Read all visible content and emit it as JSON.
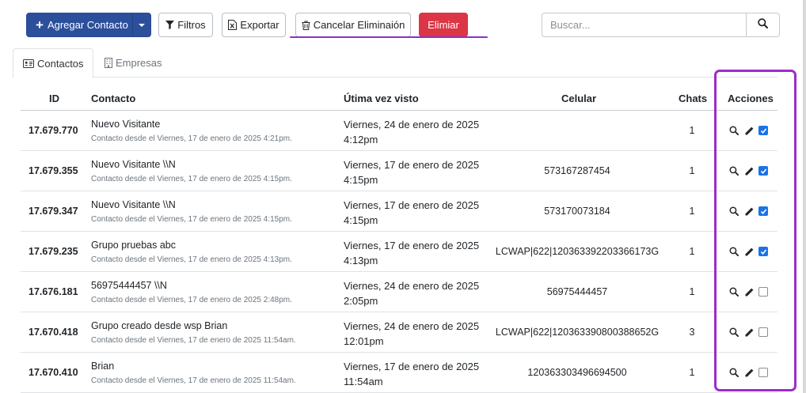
{
  "toolbar": {
    "add_contact_label": "Agregar Contacto",
    "filters_label": "Filtros",
    "export_label": "Exportar",
    "cancel_delete_label": "Cancelar Eliminaión",
    "delete_label": "Elimiar"
  },
  "search": {
    "placeholder": "Buscar..."
  },
  "tabs": [
    {
      "label": "Contactos",
      "icon": "address-card-icon",
      "active": true
    },
    {
      "label": "Empresas",
      "icon": "building-icon",
      "active": false
    }
  ],
  "table": {
    "headers": {
      "id": "ID",
      "contact": "Contacto",
      "last_seen": "Útima vez visto",
      "cell": "Celular",
      "chats": "Chats",
      "actions": "Acciones"
    },
    "rows": [
      {
        "id": "17.679.770",
        "name": "Nuevo Visitante",
        "sub": "Contacto desde el Viernes, 17 de enero de 2025 4:21pm.",
        "last_seen_1": "Viernes, 24 de enero de 2025",
        "last_seen_2": "4:12pm",
        "cell": "",
        "chats": "1",
        "checked": true
      },
      {
        "id": "17.679.355",
        "name": "Nuevo Visitante \\\\N",
        "sub": "Contacto desde el Viernes, 17 de enero de 2025 4:15pm.",
        "last_seen_1": "Viernes, 17 de enero de 2025",
        "last_seen_2": "4:15pm",
        "cell": "573167287454",
        "chats": "1",
        "checked": true
      },
      {
        "id": "17.679.347",
        "name": "Nuevo Visitante \\\\N",
        "sub": "Contacto desde el Viernes, 17 de enero de 2025 4:15pm.",
        "last_seen_1": "Viernes, 17 de enero de 2025",
        "last_seen_2": "4:15pm",
        "cell": "573170073184",
        "chats": "1",
        "checked": true
      },
      {
        "id": "17.679.235",
        "name": "Grupo pruebas abc",
        "sub": "Contacto desde el Viernes, 17 de enero de 2025 4:13pm.",
        "last_seen_1": "Viernes, 17 de enero de 2025",
        "last_seen_2": "4:13pm",
        "cell": "LCWAP|622|120363392203366173G",
        "chats": "1",
        "checked": true
      },
      {
        "id": "17.676.181",
        "name": "56975444457 \\\\N",
        "sub": "Contacto desde el Viernes, 17 de enero de 2025 2:48pm.",
        "last_seen_1": "Viernes, 24 de enero de 2025",
        "last_seen_2": "2:05pm",
        "cell": "56975444457",
        "chats": "1",
        "checked": false
      },
      {
        "id": "17.670.418",
        "name": "Grupo creado desde wsp Brian",
        "sub": "Contacto desde el Viernes, 17 de enero de 2025 11:54am.",
        "last_seen_1": "Viernes, 24 de enero de 2025",
        "last_seen_2": "12:01pm",
        "cell": "LCWAP|622|120363390800388652G",
        "chats": "3",
        "checked": false
      },
      {
        "id": "17.670.410",
        "name": "Brian",
        "sub": "Contacto desde el Viernes, 17 de enero de 2025 11:54am.",
        "last_seen_1": "Viernes, 17 de enero de 2025",
        "last_seen_2": "11:54am",
        "cell": "120363303496694500",
        "chats": "1",
        "checked": false
      }
    ]
  },
  "colors": {
    "primary": "#2c4f9c",
    "danger": "#dc3545",
    "annotation": "#9c2bc7",
    "checkbox": "#1a73e8"
  }
}
